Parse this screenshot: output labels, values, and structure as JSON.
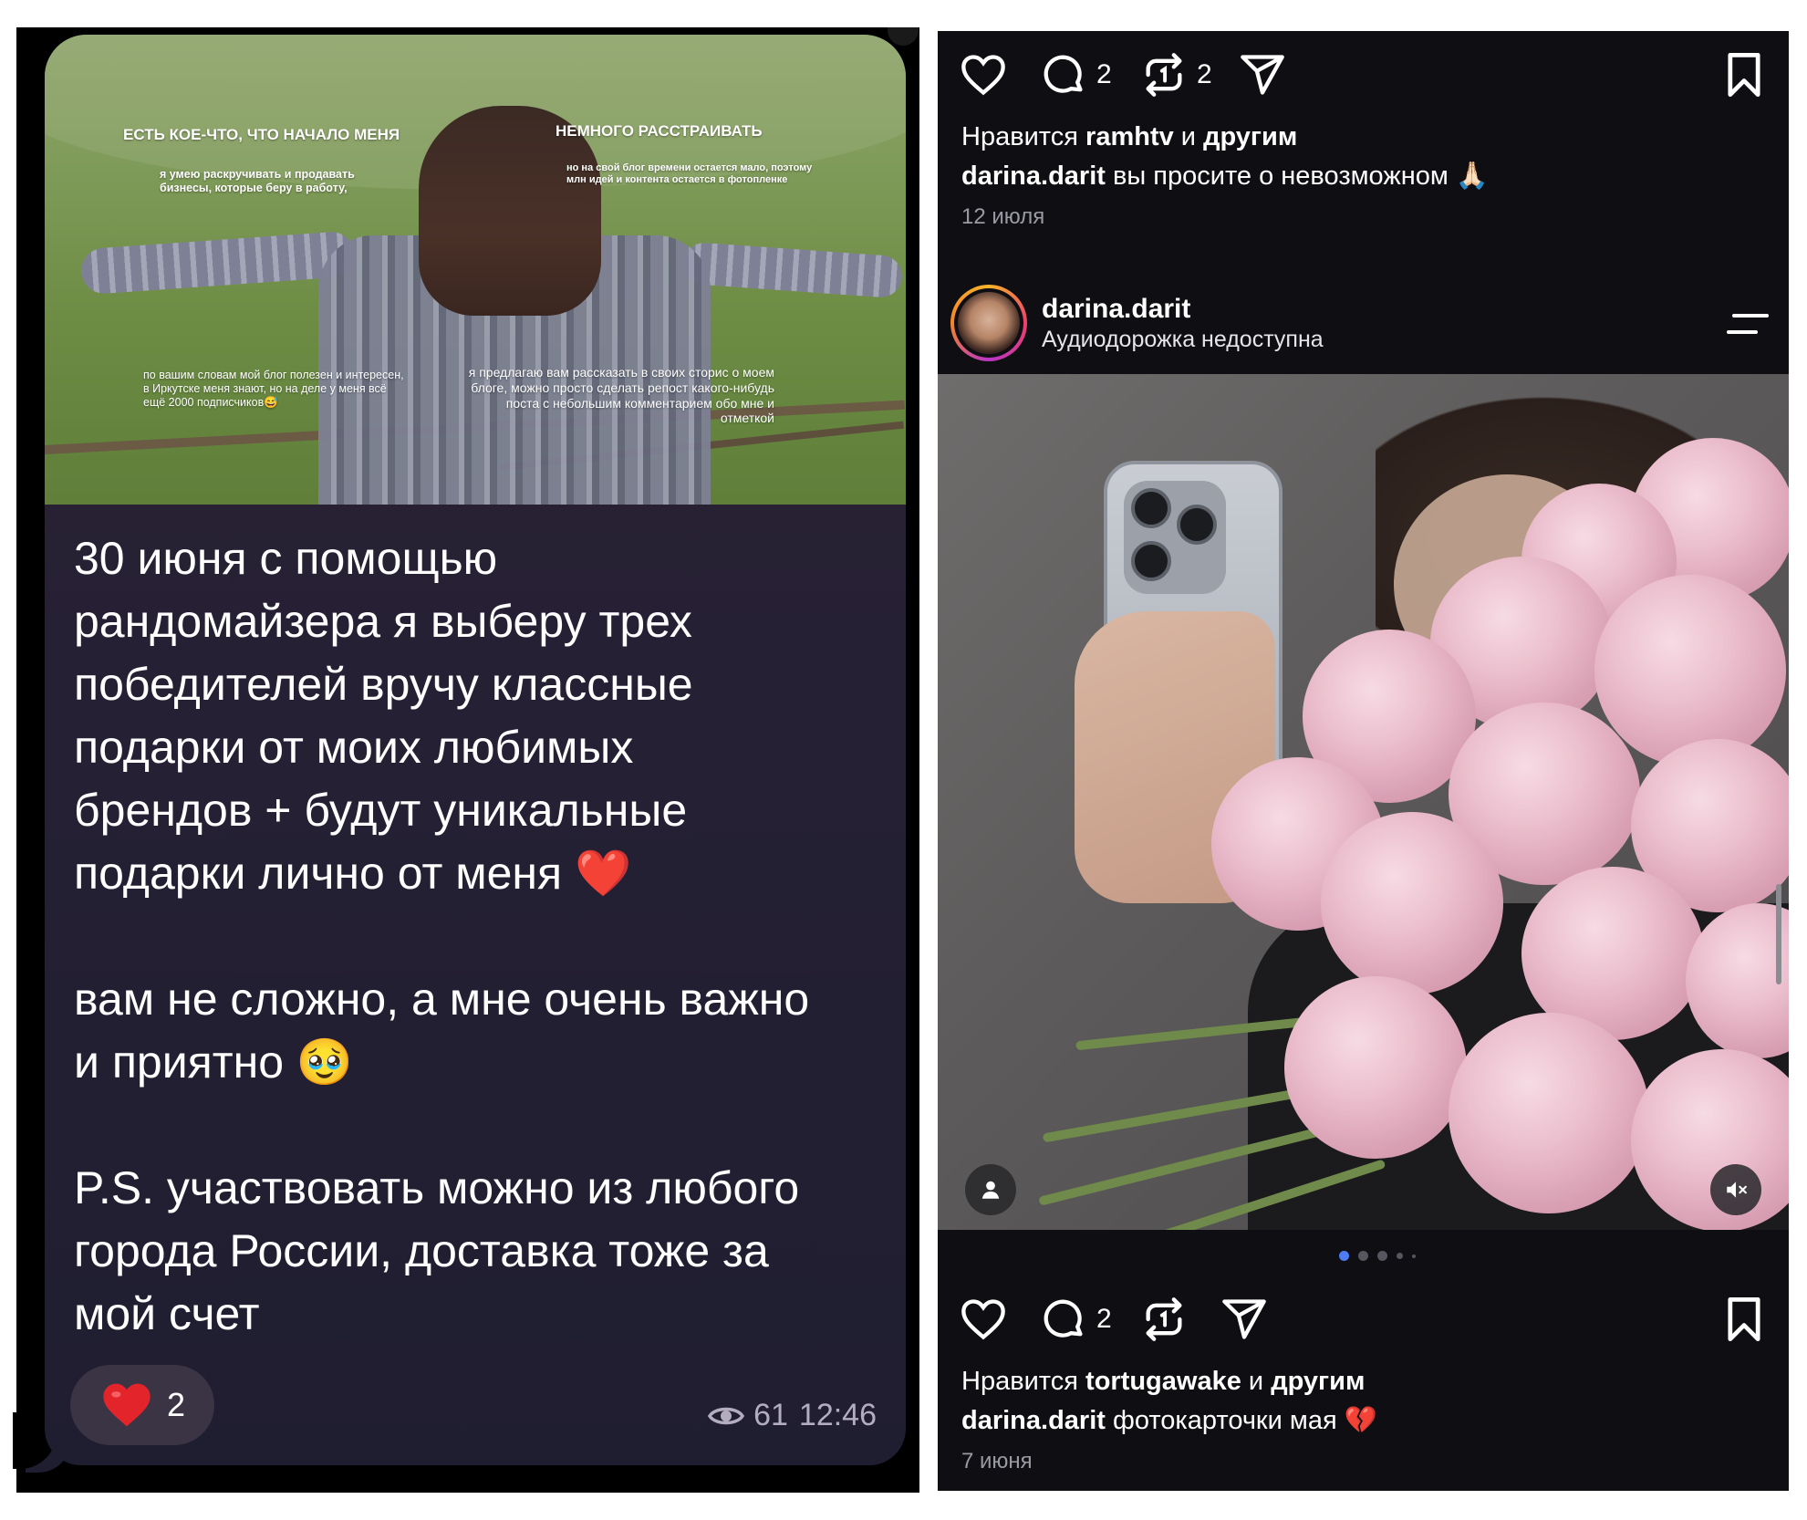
{
  "telegram_post": {
    "photo_text": {
      "heading_left": "ЕСТЬ КОЕ-ЧТО, ЧТО НАЧАЛО МЕНЯ",
      "heading_right": "НЕМНОГО РАССТРАИВАТЬ",
      "text_top_left": "я умею раскручивать и продавать бизнесы, которые беру в работу,",
      "text_top_right": "но на свой блог времени остается мало, поэтому млн идей и контента остается в фотопленке",
      "text_bottom_left": "по вашим словам мой блог полезен и интересен, в Иркутске меня знают, но на деле у меня всё ещё 2000 подписчиков😅",
      "text_bottom_right": "я предлагаю вам рассказать в своих сторис о моем блоге, можно просто сделать репост какого-нибудь поста с небольшим комментарием обо мне и отметкой"
    },
    "message_lines": [
      "30 июня с помощью",
      "рандомайзера я выберу трех",
      "победителей вручу классные",
      "подарки от моих любимых",
      "брендов + будут уникальные",
      "подарки лично от меня ❤️",
      "",
      "вам не сложно, а мне очень важно",
      "и приятно 🥹",
      "",
      "P.S. участвовать можно из любого",
      "города России, доставка тоже за",
      "мой счет"
    ],
    "reaction": {
      "emoji": "heart-icon",
      "count": "2"
    },
    "views": "61",
    "time": "12:46"
  },
  "instagram": {
    "post1": {
      "comment_count": "2",
      "repost_count": "2",
      "liked_by_prefix": "Нравится ",
      "liked_by_user": "ramhtv",
      "liked_by_and": " и ",
      "liked_by_others": "другим",
      "caption_user": "darina.darit",
      "caption_text": " вы просите о невозможном 🙏🏻",
      "date": "12 июля"
    },
    "post2": {
      "username": "darina.darit",
      "subtitle": "Аудиодорожка недоступна",
      "comment_count": "2",
      "liked_by_prefix": "Нравится ",
      "liked_by_user": "tortugawake",
      "liked_by_and": " и ",
      "liked_by_others": "другим",
      "caption_user": "darina.darit",
      "caption_text": " фотокарточки мая 💔",
      "date": "7 июня",
      "carousel_active_index": 0,
      "carousel_dot_count": 5
    },
    "colors": {
      "background": "#0f0f13",
      "carousel_active": "#4e7cf6",
      "date": "#9a9aa3"
    }
  }
}
